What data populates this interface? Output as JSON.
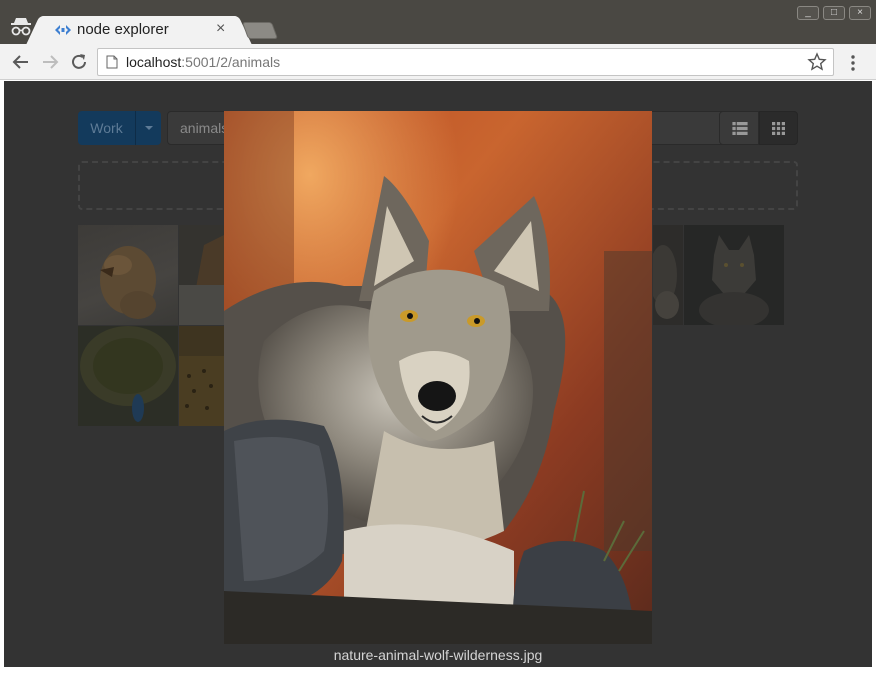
{
  "browser": {
    "tab_title": "node explorer",
    "tab_close": "×",
    "url_host": "localhost",
    "url_path": ":5001/2/animals",
    "window_buttons": [
      "_",
      "□",
      "×"
    ]
  },
  "page": {
    "work_button": "Work",
    "path_value": "animals",
    "thumbnails": [
      "golden-retriever",
      "horse",
      "wolf-pack",
      "wolf",
      "peacock",
      "cheetah"
    ]
  },
  "lightbox": {
    "filename": "nature-animal-wolf-wilderness.jpg"
  },
  "icons": {
    "incognito": "incognito-icon",
    "favicon": "node-explorer-favicon",
    "back": "back-arrow-icon",
    "forward": "forward-arrow-icon",
    "reload": "reload-icon",
    "page": "page-icon",
    "bookmark": "star-icon",
    "menu": "more-vert-icon",
    "list_view": "list-view-icon",
    "grid_view": "grid-view-icon"
  },
  "colors": {
    "work_button": "#133a5c",
    "backdrop": "#333333",
    "favicon": "#3d7fd1"
  }
}
